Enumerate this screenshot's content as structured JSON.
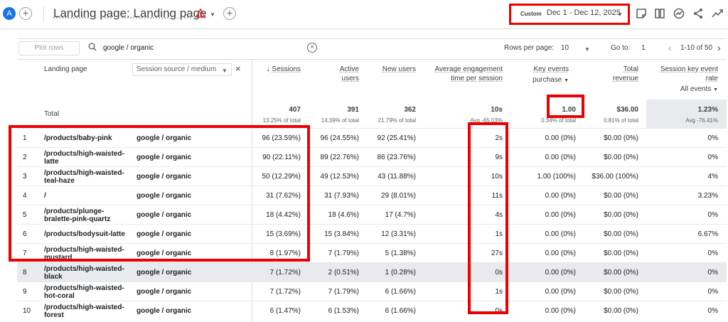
{
  "app": {
    "avatar_letter": "A",
    "title": "Landing page: Landing page",
    "date_preset": "Custom",
    "date_range": "Dec 1 - Dec 12, 2025"
  },
  "toolbar": {
    "plot_rows": "Plot rows",
    "search_value": "google / organic",
    "rows_per_page_label": "Rows per page:",
    "rows_per_page_value": "10",
    "goto_label": "Go to:",
    "goto_value": "1",
    "pagination": "1-10 of 50"
  },
  "columns": {
    "landing_page": "Landing page",
    "dimension2": "Session source / medium",
    "sessions": "Sessions",
    "active_users": [
      "Active",
      "users"
    ],
    "new_users": "New users",
    "avg_engagement": [
      "Average engagement",
      "time per session"
    ],
    "key_events": "Key events",
    "key_events_filter": "purchase",
    "total_revenue": [
      "Total",
      "revenue"
    ],
    "session_key_event_rate": [
      "Session key event",
      "rate"
    ],
    "rate_filter": "All events"
  },
  "totals": {
    "label": "Total",
    "sessions": "407",
    "sessions_sub": "13.25% of total",
    "active_users": "391",
    "active_users_sub": "14.39% of total",
    "new_users": "362",
    "new_users_sub": "21.79% of total",
    "engagement": "10s",
    "engagement_sub": "Avg -65.03%",
    "key_events": "1.00",
    "key_events_sub": "0.34% of total",
    "revenue": "$36.00",
    "revenue_sub": "0.81% of total",
    "rate": "1.23%",
    "rate_sub": "Avg -76.41%"
  },
  "rows": [
    {
      "n": "1",
      "page": "/products/baby-pink",
      "src": "google / organic",
      "sessions": "96 (23.59%)",
      "users": "96 (24.55%)",
      "new": "92 (25.41%)",
      "eng": "2s",
      "ke": "0.00 (0%)",
      "rev": "$0.00 (0%)",
      "rate": "0%"
    },
    {
      "n": "2",
      "page": "/products/high-waisted-latte",
      "src": "google / organic",
      "sessions": "90 (22.11%)",
      "users": "89 (22.76%)",
      "new": "86 (23.76%)",
      "eng": "9s",
      "ke": "0.00 (0%)",
      "rev": "$0.00 (0%)",
      "rate": "0%"
    },
    {
      "n": "3",
      "page": "/products/high-waisted-teal-haze",
      "src": "google / organic",
      "sessions": "50 (12.29%)",
      "users": "49 (12.53%)",
      "new": "43 (11.88%)",
      "eng": "10s",
      "ke": "1.00 (100%)",
      "rev": "$36.00 (100%)",
      "rate": "4%"
    },
    {
      "n": "4",
      "page": "/",
      "src": "google / organic",
      "sessions": "31 (7.62%)",
      "users": "31 (7.93%)",
      "new": "29 (8.01%)",
      "eng": "11s",
      "ke": "0.00 (0%)",
      "rev": "$0.00 (0%)",
      "rate": "3.23%"
    },
    {
      "n": "5",
      "page": "/products/plunge-bralette-pink-quartz",
      "src": "google / organic",
      "sessions": "18 (4.42%)",
      "users": "18 (4.6%)",
      "new": "17 (4.7%)",
      "eng": "4s",
      "ke": "0.00 (0%)",
      "rev": "$0.00 (0%)",
      "rate": "0%"
    },
    {
      "n": "6",
      "page": "/products/bodysuit-latte",
      "src": "google / organic",
      "sessions": "15 (3.69%)",
      "users": "15 (3.84%)",
      "new": "12 (3.31%)",
      "eng": "1s",
      "ke": "0.00 (0%)",
      "rev": "$0.00 (0%)",
      "rate": "6.67%"
    },
    {
      "n": "7",
      "page": "/products/high-waisted-mustard",
      "src": "google / organic",
      "sessions": "8 (1.97%)",
      "users": "7 (1.79%)",
      "new": "5 (1.38%)",
      "eng": "27s",
      "ke": "0.00 (0%)",
      "rev": "$0.00 (0%)",
      "rate": "0%"
    },
    {
      "n": "8",
      "page": "/products/high-waisted-black",
      "src": "google / organic",
      "sessions": "7 (1.72%)",
      "users": "2 (0.51%)",
      "new": "1 (0.28%)",
      "eng": "0s",
      "ke": "0.00 (0%)",
      "rev": "$0.00 (0%)",
      "rate": "0%"
    },
    {
      "n": "9",
      "page": "/products/high-waisted-hot-coral",
      "src": "google / organic",
      "sessions": "7 (1.72%)",
      "users": "7 (1.79%)",
      "new": "6 (1.66%)",
      "eng": "1s",
      "ke": "0.00 (0%)",
      "rev": "$0.00 (0%)",
      "rate": "0%"
    },
    {
      "n": "10",
      "page": "/products/high-waisted-forest",
      "src": "google / organic",
      "sessions": "6 (1.47%)",
      "users": "6 (1.53%)",
      "new": "6 (1.66%)",
      "eng": "0s",
      "ke": "0.00 (0%)",
      "rev": "$0.00 (0%)",
      "rate": "0%"
    }
  ],
  "colors": {
    "accent": "#1a73e8",
    "highlight": "#e00000",
    "row_highlight": "#e8eaed"
  },
  "icons": [
    "plus-icon",
    "warning-icon",
    "chevron-down-icon",
    "report-icon",
    "compare-icon",
    "insights-icon",
    "share-icon",
    "trend-icon",
    "search-icon",
    "clear-icon",
    "chevron-left-icon",
    "chevron-right-icon",
    "arrow-down-icon",
    "close-icon"
  ]
}
